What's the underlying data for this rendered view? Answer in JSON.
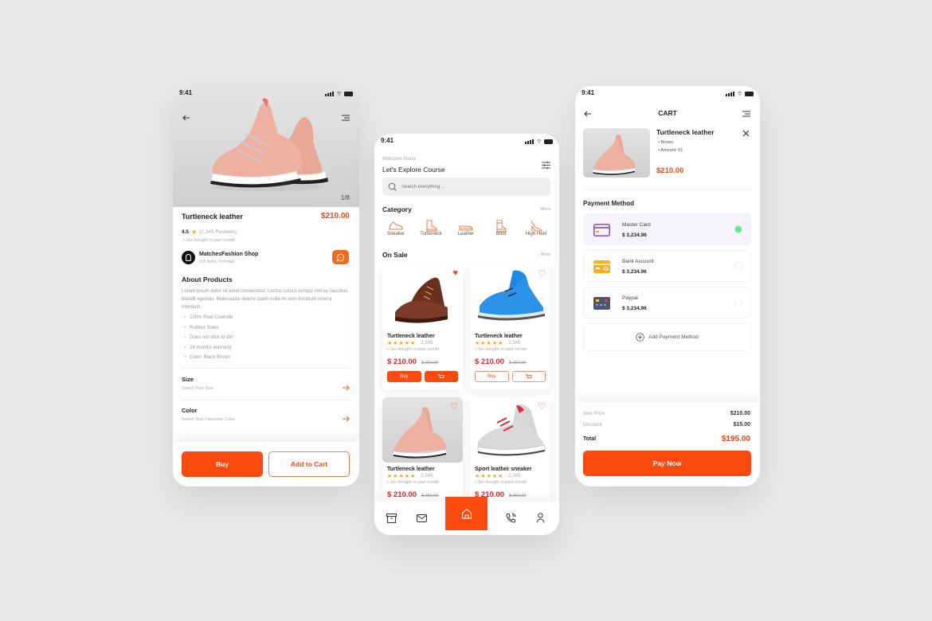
{
  "status_time": "9:41",
  "product_screen": {
    "image_counter": "1/8",
    "title": "Turtleneck leather",
    "price": "$210.00",
    "rating": "4.5",
    "reviews": "(2,345 Reviews)",
    "bought": "1k+ bought in past month",
    "shop_name": "MatchesFashion Shop",
    "shop_meta": "325 items, Potential",
    "about_title": "About Products",
    "about_text": "Lorem ipsum dolor sit amet consectetur. Lectus cursus tempor nisl eu faucibus blandit egestas. Malesuada viverra quam nulla mi sem tincidunt viverra interdum.",
    "features": [
      "100% Real Cowhide",
      "Rubber Soles",
      "Does not stick to dirt",
      "24 months warranty",
      "Color: Black Brown"
    ],
    "size_label": "Size",
    "size_sub": "Select Your Size",
    "color_label": "Color",
    "color_sub": "Select Your Favourite Color",
    "buy_label": "Buy",
    "cart_label": "Add to Cart"
  },
  "home_screen": {
    "welcome": "Welcome Maria",
    "heading": "Let's Explore Course",
    "search_placeholder": "Search everything ...",
    "category_title": "Category",
    "more_label": "More",
    "categories": [
      "Sneaker",
      "Turtleneck",
      "Leather",
      "Boot",
      "High Heel"
    ],
    "sale_title": "On Sale",
    "products": [
      {
        "name": "Turtleneck leather",
        "rating_count": "2,345",
        "bought": "1k+ bought in past month",
        "price": "$ 210.00",
        "old_price": "$ 250.00",
        "favorited": true,
        "buy_label": "Buy"
      },
      {
        "name": "Turtleneck leather",
        "rating_count": "2,345",
        "bought": "1k+ bought in past month",
        "price": "$ 210.00",
        "old_price": "$ 250.00",
        "favorited": false,
        "buy_label": "Buy"
      },
      {
        "name": "Turtleneck leather",
        "rating_count": "2,345",
        "bought": "1k+ bought in past month",
        "price": "$ 210.00",
        "old_price": "$ 250.00",
        "favorited": false
      },
      {
        "name": "Sport leather sneaker",
        "rating_count": "2,345",
        "bought": "1k+ bought in past month",
        "price": "$ 210.00",
        "old_price": "$ 250.00",
        "favorited": false
      }
    ],
    "stars": "★★★★★"
  },
  "cart_screen": {
    "title": "CART",
    "item_name": "Turtleneck leather",
    "item_color": "Brown",
    "item_amount": "Amount: 01",
    "item_price": "$210.00",
    "payment_title": "Payment Method",
    "methods": [
      {
        "name": "Master Card",
        "amount": "$ 3,234.96",
        "selected": true
      },
      {
        "name": "Bank Account",
        "amount": "$ 3,234.96",
        "selected": false
      },
      {
        "name": "Paypal",
        "amount": "$ 3,234.96",
        "selected": false
      }
    ],
    "add_method": "Add Payment Method",
    "item_price_label": "Item Price",
    "item_price_value": "$210.00",
    "discount_label": "Discount",
    "discount_value": "$15.00",
    "total_label": "Total",
    "total_value": "$195.00",
    "pay_label": "Pay Now"
  },
  "colors": {
    "accent": "#f04a12",
    "price_red": "#e5282c",
    "star": "#f5a623",
    "selected_bg": "#f6f3fb",
    "radio_on": "#6ee09a"
  }
}
